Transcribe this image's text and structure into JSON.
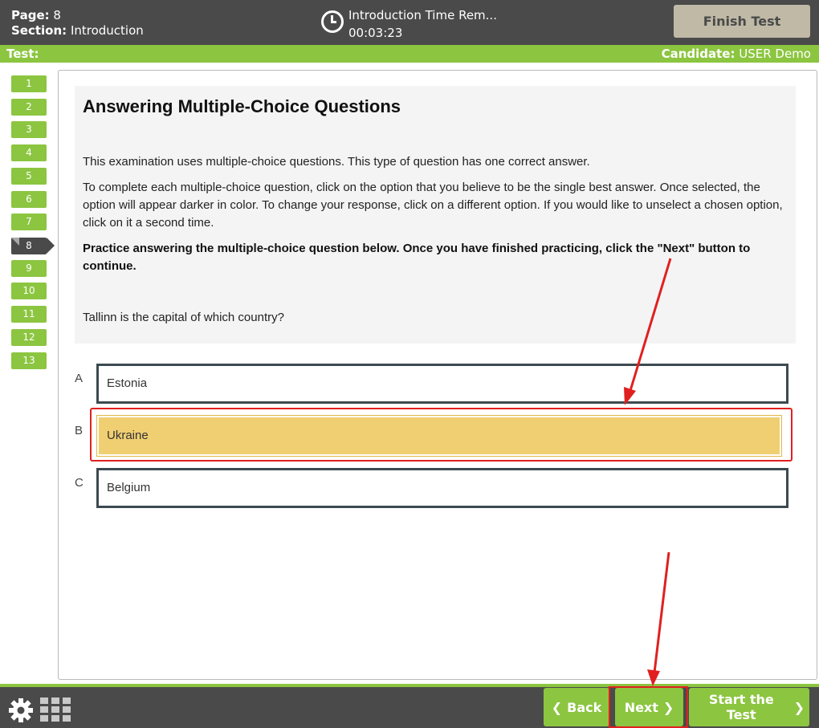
{
  "header": {
    "page_label": "Page:",
    "page_value": "8",
    "section_label": "Section:",
    "section_value": "Introduction",
    "timer_label": "Introduction Time Rem...",
    "timer_value": "00:03:23",
    "finish_label": "Finish Test"
  },
  "subheader": {
    "test_label": "Test:",
    "candidate_label": "Candidate:",
    "candidate_value": "USER Demo"
  },
  "question_nav": {
    "items": [
      "1",
      "2",
      "3",
      "4",
      "5",
      "6",
      "7",
      "8",
      "9",
      "10",
      "11",
      "12",
      "13"
    ],
    "current": "8"
  },
  "content": {
    "title": "Answering Multiple-Choice Questions",
    "para1": "This examination uses multiple-choice questions. This type of question has one correct answer.",
    "para2": "To complete each multiple-choice question, click on the option that you believe to be the single best answer. Once selected, the option will appear darker in color. To change your response, click on a different option. If you would like to unselect a chosen option, click on it a second time.",
    "para3": "Practice answering the multiple-choice question below. Once you have finished practicing, click the \"Next\" button to continue.",
    "question": "Tallinn is the capital of which country?",
    "options": [
      {
        "letter": "A",
        "text": "Estonia"
      },
      {
        "letter": "B",
        "text": "Ukraine"
      },
      {
        "letter": "C",
        "text": "Belgium"
      }
    ],
    "selected_option": "B"
  },
  "footer": {
    "back_label": "Back",
    "next_label": "Next",
    "start_label": "Start the Test"
  },
  "icons": {
    "settings": "gear-icon",
    "overview": "grid-icon",
    "timer": "clock-icon"
  },
  "colors": {
    "header_bg": "#4a4a4a",
    "accent_green": "#8cc540",
    "selected_option": "#f0cf72",
    "annotation_red": "#e02020"
  }
}
